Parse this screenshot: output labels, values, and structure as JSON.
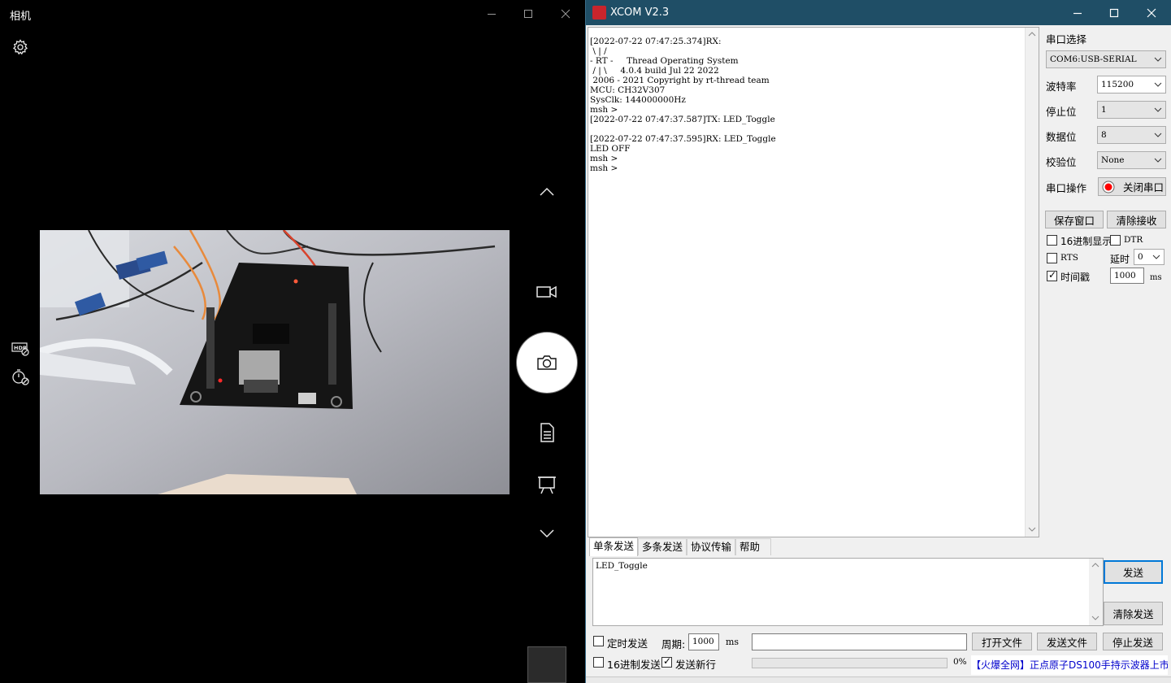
{
  "camera": {
    "title": "相机",
    "icons": {
      "settings": "gear-icon",
      "hdr": "hdr-icon",
      "timer": "self-timer-icon",
      "up": "chevron-up-icon",
      "video": "video-mode-icon",
      "photo": "camera-shutter-icon",
      "document": "document-mode-icon",
      "whiteboard": "whiteboard-mode-icon",
      "down": "chevron-down-icon"
    }
  },
  "xcom": {
    "title": "XCOM V2.3",
    "receive_log": "[2022-07-22 07:47:25.374]RX:\n \\ | /\n- RT -     Thread Operating System\n / | \\     4.0.4 build Jul 22 2022\n 2006 - 2021 Copyright by rt-thread team\nMCU: CH32V307\nSysClk: 144000000Hz\nmsh >\n[2022-07-22 07:47:37.587]TX: LED_Toggle\n\n[2022-07-22 07:47:37.595]RX: LED_Toggle\nLED OFF\nmsh >\nmsh >",
    "panel": {
      "port_label": "串口选择",
      "port_value": "COM6:USB-SERIAL",
      "baud_label": "波特率",
      "baud_value": "115200",
      "stop_label": "停止位",
      "stop_value": "1",
      "data_label": "数据位",
      "data_value": "8",
      "parity_label": "校验位",
      "parity_value": "None",
      "op_label": "串口操作",
      "close_port": "关闭串口",
      "save_window": "保存窗口",
      "clear_recv": "清除接收",
      "hex_display": "16进制显示",
      "dtr": "DTR",
      "rts": "RTS",
      "delay_label": "延时",
      "delay_value": "0",
      "timestamp": "时间戳",
      "timestamp_value": "1000",
      "timestamp_unit": "ms",
      "hex_display_checked": false,
      "dtr_checked": false,
      "rts_checked": false,
      "timestamp_checked": true
    },
    "tabs": [
      "单条发送",
      "多条发送",
      "协议传输",
      "帮助"
    ],
    "send": {
      "text": "LED_Toggle",
      "send_button": "发送",
      "clear_send": "清除发送",
      "timed_send": "定时发送",
      "period_label": "周期:",
      "period_value": "1000",
      "period_unit": "ms",
      "open_file": "打开文件",
      "send_file": "发送文件",
      "stop_send": "停止发送",
      "hex_send": "16进制发送",
      "newline": "发送新行",
      "timed_send_checked": false,
      "hex_send_checked": false,
      "newline_checked": true,
      "progress_percent": "0%",
      "progress_value": 0
    },
    "ad": {
      "bracket_text": "【火爆全网】",
      "rest_text": "正点原子DS100手持示波器上市"
    }
  }
}
